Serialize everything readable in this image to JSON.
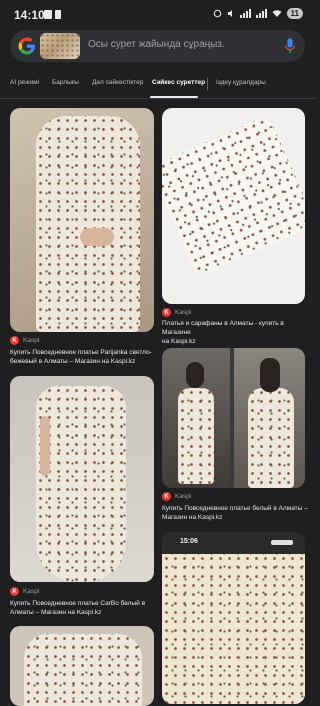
{
  "status_bar": {
    "time": "14:10",
    "battery": "11"
  },
  "search": {
    "placeholder": "Осы сурет жайында сұраңыз."
  },
  "tabs": [
    {
      "label": "AI режимі"
    },
    {
      "label": "Барлығы"
    },
    {
      "label": "Дәл сәйкестіктер"
    },
    {
      "label": "Сәйкес суреттер"
    },
    {
      "label": "Іздеу құралдары"
    }
  ],
  "results": [
    {
      "source": "Kaspi",
      "title_line1": "Купить Повседневное платье Parijanka светло-",
      "title_line2": "бежевый в Алматы – Магазин на Kaspi.kz"
    },
    {
      "source": "Kaspi",
      "title_line1": "Платья и сарафаны в Алматы - купить в Магазине",
      "title_line2": "на Kaspi.kz"
    },
    {
      "source": "Kaspi",
      "title_line1": "Купить Повседневное платье белый в Алматы –",
      "title_line2": "Магазин на Kaspi.kz"
    },
    {
      "source": "Kaspi",
      "title_line1": "Купить Повседневное платье CarBo белый в",
      "title_line2": "Алматы – Магазин на Kaspi.kz"
    }
  ],
  "embedded_phone": {
    "time": "15:06"
  },
  "colors": {
    "background": "#1f1f21",
    "search_bar": "#303134",
    "kaspi_red": "#e53935"
  }
}
